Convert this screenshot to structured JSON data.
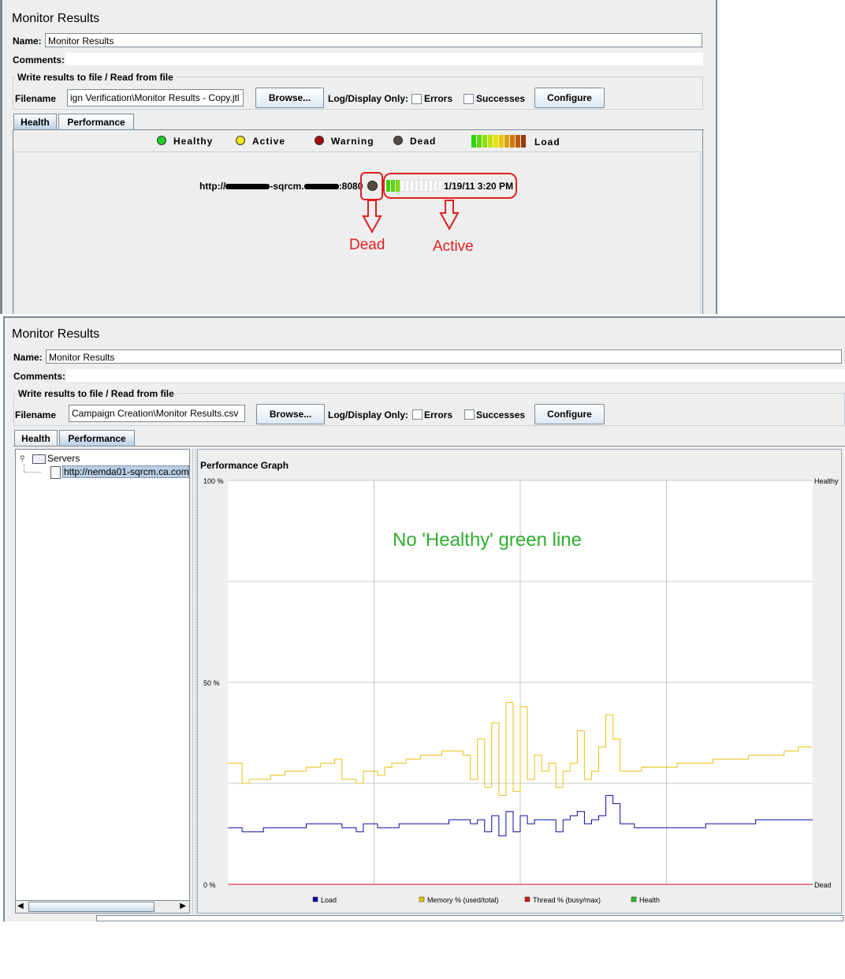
{
  "panel_top": {
    "title": "Monitor Results",
    "name_label": "Name:",
    "name_value": "Monitor Results",
    "comments_label": "Comments:",
    "file_group_title": "Write results to file / Read from file",
    "filename_label": "Filename",
    "filename_value": "ign Verification\\Monitor Results - Copy.jtl",
    "browse_label": "Browse...",
    "log_display_label": "Log/Display Only:",
    "errors_label": "Errors",
    "successes_label": "Successes",
    "configure_label": "Configure",
    "tabs": [
      {
        "label": "Health",
        "selected": true
      },
      {
        "label": "Performance",
        "selected": false
      }
    ],
    "legend": {
      "healthy": {
        "label": "Healthy",
        "color": "#22cc22"
      },
      "active": {
        "label": "Active",
        "color": "#f2e40f"
      },
      "warning": {
        "label": "Warning",
        "color": "#a30f0f"
      },
      "dead": {
        "label": "Dead",
        "color": "#554a40"
      },
      "load": {
        "label": "Load",
        "colors": [
          "#2bd40a",
          "#5fd80a",
          "#8ede0a",
          "#bfe20a",
          "#e6e20a",
          "#e8c40a",
          "#e09e0a",
          "#d0780a",
          "#bb5a0a",
          "#9a3a0a"
        ]
      }
    },
    "server": {
      "url_prefix": "http://",
      "url_mid": "-sqrcm.",
      "url_suffix": ":8080",
      "status": "dead",
      "status_color": "#554a40",
      "load_filled": 3,
      "load_total": 12,
      "timestamp": "1/19/11 3:20 PM"
    },
    "annotations": {
      "dead": "Dead",
      "active": "Active"
    }
  },
  "panel_bottom": {
    "title": "Monitor Results",
    "name_label": "Name:",
    "name_value": "Monitor Results",
    "comments_label": "Comments:",
    "file_group_title": "Write results to file / Read from file",
    "filename_label": "Filename",
    "filename_value": "Campaign Creation\\Monitor Results.csv",
    "browse_label": "Browse...",
    "log_display_label": "Log/Display Only:",
    "errors_label": "Errors",
    "successes_label": "Successes",
    "configure_label": "Configure",
    "tabs": [
      {
        "label": "Health",
        "selected": false
      },
      {
        "label": "Performance",
        "selected": true
      }
    ],
    "tree": {
      "root": "Servers",
      "child": "http://nemda01-sqrcm.ca.com"
    },
    "graph": {
      "title": "Performance Graph",
      "annotation": "No 'Healthy' green line"
    }
  },
  "chart_data": {
    "type": "line",
    "title": "Performance Graph",
    "ylim": [
      0,
      100
    ],
    "y_ticks": [
      "100 %",
      "50 %",
      "0 %"
    ],
    "right_labels": {
      "top": "Healthy",
      "bottom": "Dead"
    },
    "grid": true,
    "legend_position": "bottom",
    "series": [
      {
        "name": "Load",
        "color": "#0a0aa8",
        "values": [
          14,
          14,
          13,
          13,
          13,
          14,
          14,
          14,
          14,
          14,
          14,
          15,
          15,
          15,
          15,
          15,
          14,
          14,
          13,
          15,
          15,
          14,
          14,
          14,
          15,
          15,
          15,
          15,
          15,
          15,
          15,
          16,
          16,
          16,
          15,
          16,
          13,
          17,
          12,
          18,
          13,
          17,
          15,
          16,
          16,
          16,
          13,
          16,
          17,
          18,
          15,
          16,
          17,
          22,
          20,
          15,
          15,
          14,
          14,
          14,
          14,
          14,
          14,
          14,
          14,
          14,
          14,
          15,
          15,
          15,
          15,
          15,
          15,
          15,
          16,
          16,
          16,
          16,
          16,
          16,
          16,
          16,
          16
        ]
      },
      {
        "name": "Memory % (used/total)",
        "color": "#e8c010",
        "values": [
          30,
          30,
          25,
          26,
          26,
          26,
          27,
          27,
          28,
          28,
          28,
          29,
          29,
          30,
          30,
          31,
          26,
          26,
          25,
          28,
          28,
          27,
          29,
          30,
          30,
          31,
          31,
          32,
          32,
          32,
          33,
          33,
          33,
          32,
          26,
          36,
          24,
          40,
          22,
          45,
          23,
          44,
          26,
          32,
          28,
          30,
          24,
          28,
          30,
          38,
          26,
          28,
          34,
          42,
          36,
          28,
          28,
          28,
          29,
          29,
          29,
          29,
          29,
          30,
          30,
          30,
          30,
          30,
          31,
          31,
          31,
          31,
          31,
          32,
          32,
          32,
          32,
          32,
          33,
          33,
          34,
          34,
          34
        ]
      },
      {
        "name": "Thread % (busy/max)",
        "color": "#d81414",
        "values": [
          0,
          0,
          0,
          0,
          0,
          0,
          0,
          0,
          0,
          0,
          0,
          0,
          0,
          0,
          0,
          0,
          0,
          0,
          0,
          0,
          0,
          0,
          0,
          0,
          0,
          0,
          0,
          0,
          0,
          0,
          0,
          0,
          0,
          0,
          0,
          0,
          0,
          0,
          0,
          0,
          0,
          0,
          0,
          0,
          0,
          0,
          0,
          0,
          0,
          0,
          0,
          0,
          0,
          0,
          0,
          0,
          0,
          0,
          0,
          0,
          0,
          0,
          0,
          0,
          0,
          0,
          0,
          0,
          0,
          0,
          0,
          0,
          0,
          0,
          0,
          0,
          0,
          0,
          0,
          0,
          0,
          0,
          0
        ]
      },
      {
        "name": "Health",
        "color": "#22c022",
        "values": []
      }
    ]
  }
}
